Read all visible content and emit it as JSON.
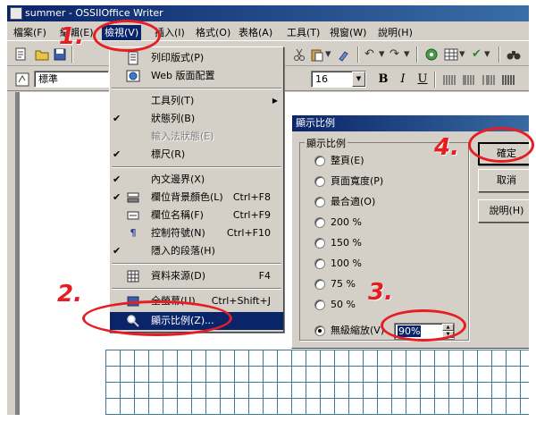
{
  "window": {
    "title": "summer - OSSIIOffice Writer"
  },
  "menubar": {
    "items": [
      {
        "label": "檔案(F)"
      },
      {
        "label": "編輯(E)"
      },
      {
        "label": "檢視(V)"
      },
      {
        "label": "插入(I)"
      },
      {
        "label": "格式(O)"
      },
      {
        "label": "表格(A)"
      },
      {
        "label": "工具(T)"
      },
      {
        "label": "視窗(W)"
      },
      {
        "label": "說明(H)"
      }
    ]
  },
  "formatting": {
    "style": "標準",
    "font_size": "16",
    "bold_label": "B",
    "italic_label": "I",
    "underline_label": "U"
  },
  "view_menu": {
    "items": [
      {
        "label": "列印版式(P)",
        "icon": "print-layout-icon"
      },
      {
        "label": "Web 版面配置",
        "icon": "web-layout-icon"
      },
      {
        "label": "工具列(T)",
        "submenu": true
      },
      {
        "label": "狀態列(B)",
        "checked": true
      },
      {
        "label": "輸入法狀態(E)",
        "disabled": true
      },
      {
        "label": "標尺(R)",
        "checked": true
      },
      {
        "label": "內文邊界(X)",
        "checked": true
      },
      {
        "label": "欄位背景顏色(L)",
        "shortcut": "Ctrl+F8",
        "checked": true,
        "icon": "field-shading-icon"
      },
      {
        "label": "欄位名稱(F)",
        "shortcut": "Ctrl+F9",
        "icon": "field-names-icon"
      },
      {
        "label": "控制符號(N)",
        "shortcut": "Ctrl+F10",
        "icon": "pilcrow-icon"
      },
      {
        "label": "隱入的段落(H)",
        "checked": true
      },
      {
        "label": "資料來源(D)",
        "shortcut": "F4",
        "icon": "data-source-icon"
      },
      {
        "label": "全螢幕(U)",
        "shortcut": "Ctrl+Shift+J",
        "icon": "full-screen-icon"
      },
      {
        "label": "顯示比例(Z)...",
        "icon": "zoom-icon",
        "highlighted": true
      }
    ]
  },
  "zoom_dialog": {
    "title": "顯示比例",
    "group_label": "顯示比例",
    "options": [
      {
        "label": "整頁(E)"
      },
      {
        "label": "頁面寬度(P)"
      },
      {
        "label": "最合適(O)"
      },
      {
        "label": "200 %"
      },
      {
        "label": "150 %"
      },
      {
        "label": "100 %"
      },
      {
        "label": "75 %"
      },
      {
        "label": "50 %"
      },
      {
        "label": "無級縮放(V)",
        "checked": true
      }
    ],
    "variable_value": "90%",
    "ok_label": "確定",
    "cancel_label": "取消",
    "help_label": "說明(H)"
  },
  "annotations": {
    "color": "#e51e24",
    "steps": [
      "1.",
      "2.",
      "3.",
      "4."
    ]
  },
  "colors": {
    "titlebar": "#0a246a",
    "highlight": "#0a246a",
    "face": "#d4d0c8",
    "grid": "#3b7a96"
  }
}
